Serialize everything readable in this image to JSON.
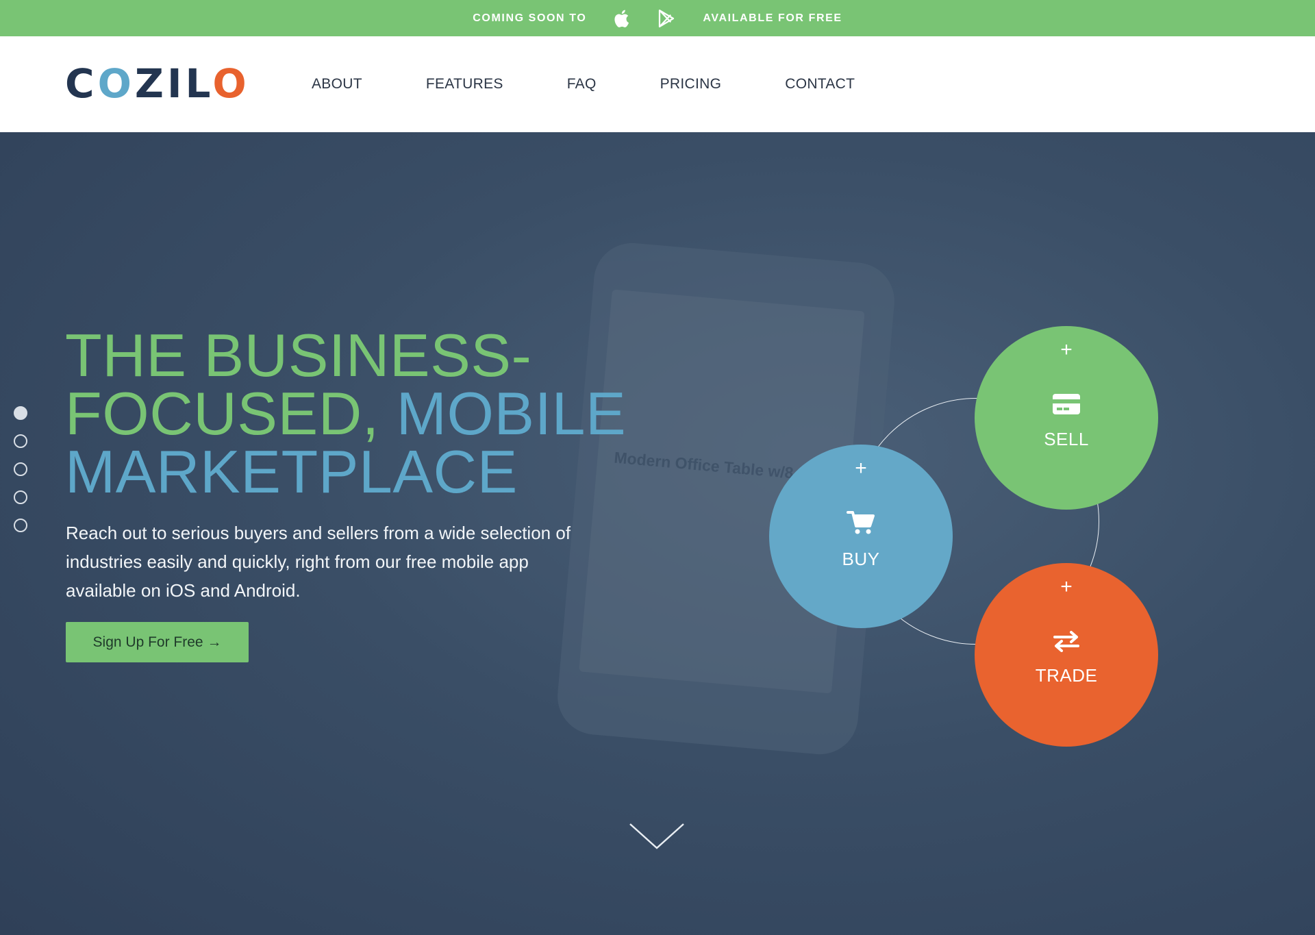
{
  "banner": {
    "coming_soon": "COMING SOON TO",
    "available": "AVAILABLE FOR FREE",
    "icons": [
      "apple-icon",
      "google-play-icon"
    ],
    "bg_color": "#79c474"
  },
  "header": {
    "logo": "COZILO",
    "nav": [
      "ABOUT",
      "FEATURES",
      "FAQ",
      "PRICING",
      "CONTACT"
    ]
  },
  "hero": {
    "headline": {
      "line1": "THE BUSINESS-",
      "line2a": "FOCUSED, ",
      "line2b": "MOBILE",
      "line3": "MARKETPLACE"
    },
    "subtext": "Reach out to serious buyers and sellers from a wide selection of industries easily and quickly, right from our free mobile app available on iOS and Android.",
    "cta": "Sign Up For Free →",
    "pager": {
      "count": 5,
      "active": 1
    },
    "background_phone_text": "Modern Office Table w/8 Chairs"
  },
  "actions": [
    {
      "label": "SELL",
      "icon": "credit-card-icon",
      "color": "#79c474"
    },
    {
      "label": "BUY",
      "icon": "shopping-cart-icon",
      "color": "#64a8c8"
    },
    {
      "label": "TRADE",
      "icon": "swap-arrows-icon",
      "color": "#e9632f"
    }
  ],
  "colors": {
    "green": "#79c474",
    "blue": "#5ea7c9",
    "orange": "#e9632f",
    "navy": "#233550",
    "hero_bg": "#34475f"
  }
}
